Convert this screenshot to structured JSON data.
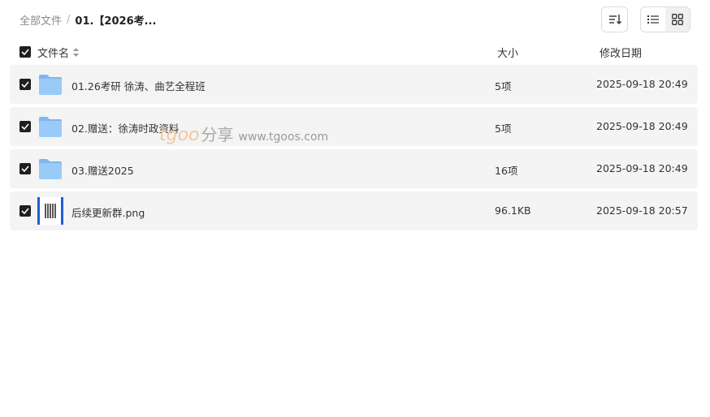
{
  "breadcrumb": {
    "root": "全部文件",
    "separator": "/",
    "current": "01.【2026考..."
  },
  "toolbar": {
    "sort_icon": "sort-icon",
    "list_view_icon": "list-view-icon",
    "grid_view_icon": "grid-view-icon",
    "active_view": "grid"
  },
  "table": {
    "headers": {
      "name": "文件名",
      "size": "大小",
      "date": "修改日期"
    },
    "rows": [
      {
        "name": "01.26考研 徐涛、曲艺全程班",
        "size": "5项",
        "date": "2025-09-18 20:49",
        "type": "folder",
        "checked": true
      },
      {
        "name": "02.赠送：徐涛时政资料",
        "size": "5项",
        "date": "2025-09-18 20:49",
        "type": "folder",
        "checked": true
      },
      {
        "name": "03.赠送2025",
        "size": "16项",
        "date": "2025-09-18 20:49",
        "type": "folder",
        "checked": true
      },
      {
        "name": "后续更新群.png",
        "size": "96.1KB",
        "date": "2025-09-18 20:57",
        "type": "image",
        "checked": true
      }
    ]
  },
  "watermark": {
    "logo": "tgoo",
    "label": "分享",
    "url": "www.tgoos.com"
  },
  "colors": {
    "folder": "#8ec3f7",
    "row_bg": "#f4f4f4",
    "checkbox": "#1f1f1f",
    "image_border": "#1d5fd6"
  }
}
